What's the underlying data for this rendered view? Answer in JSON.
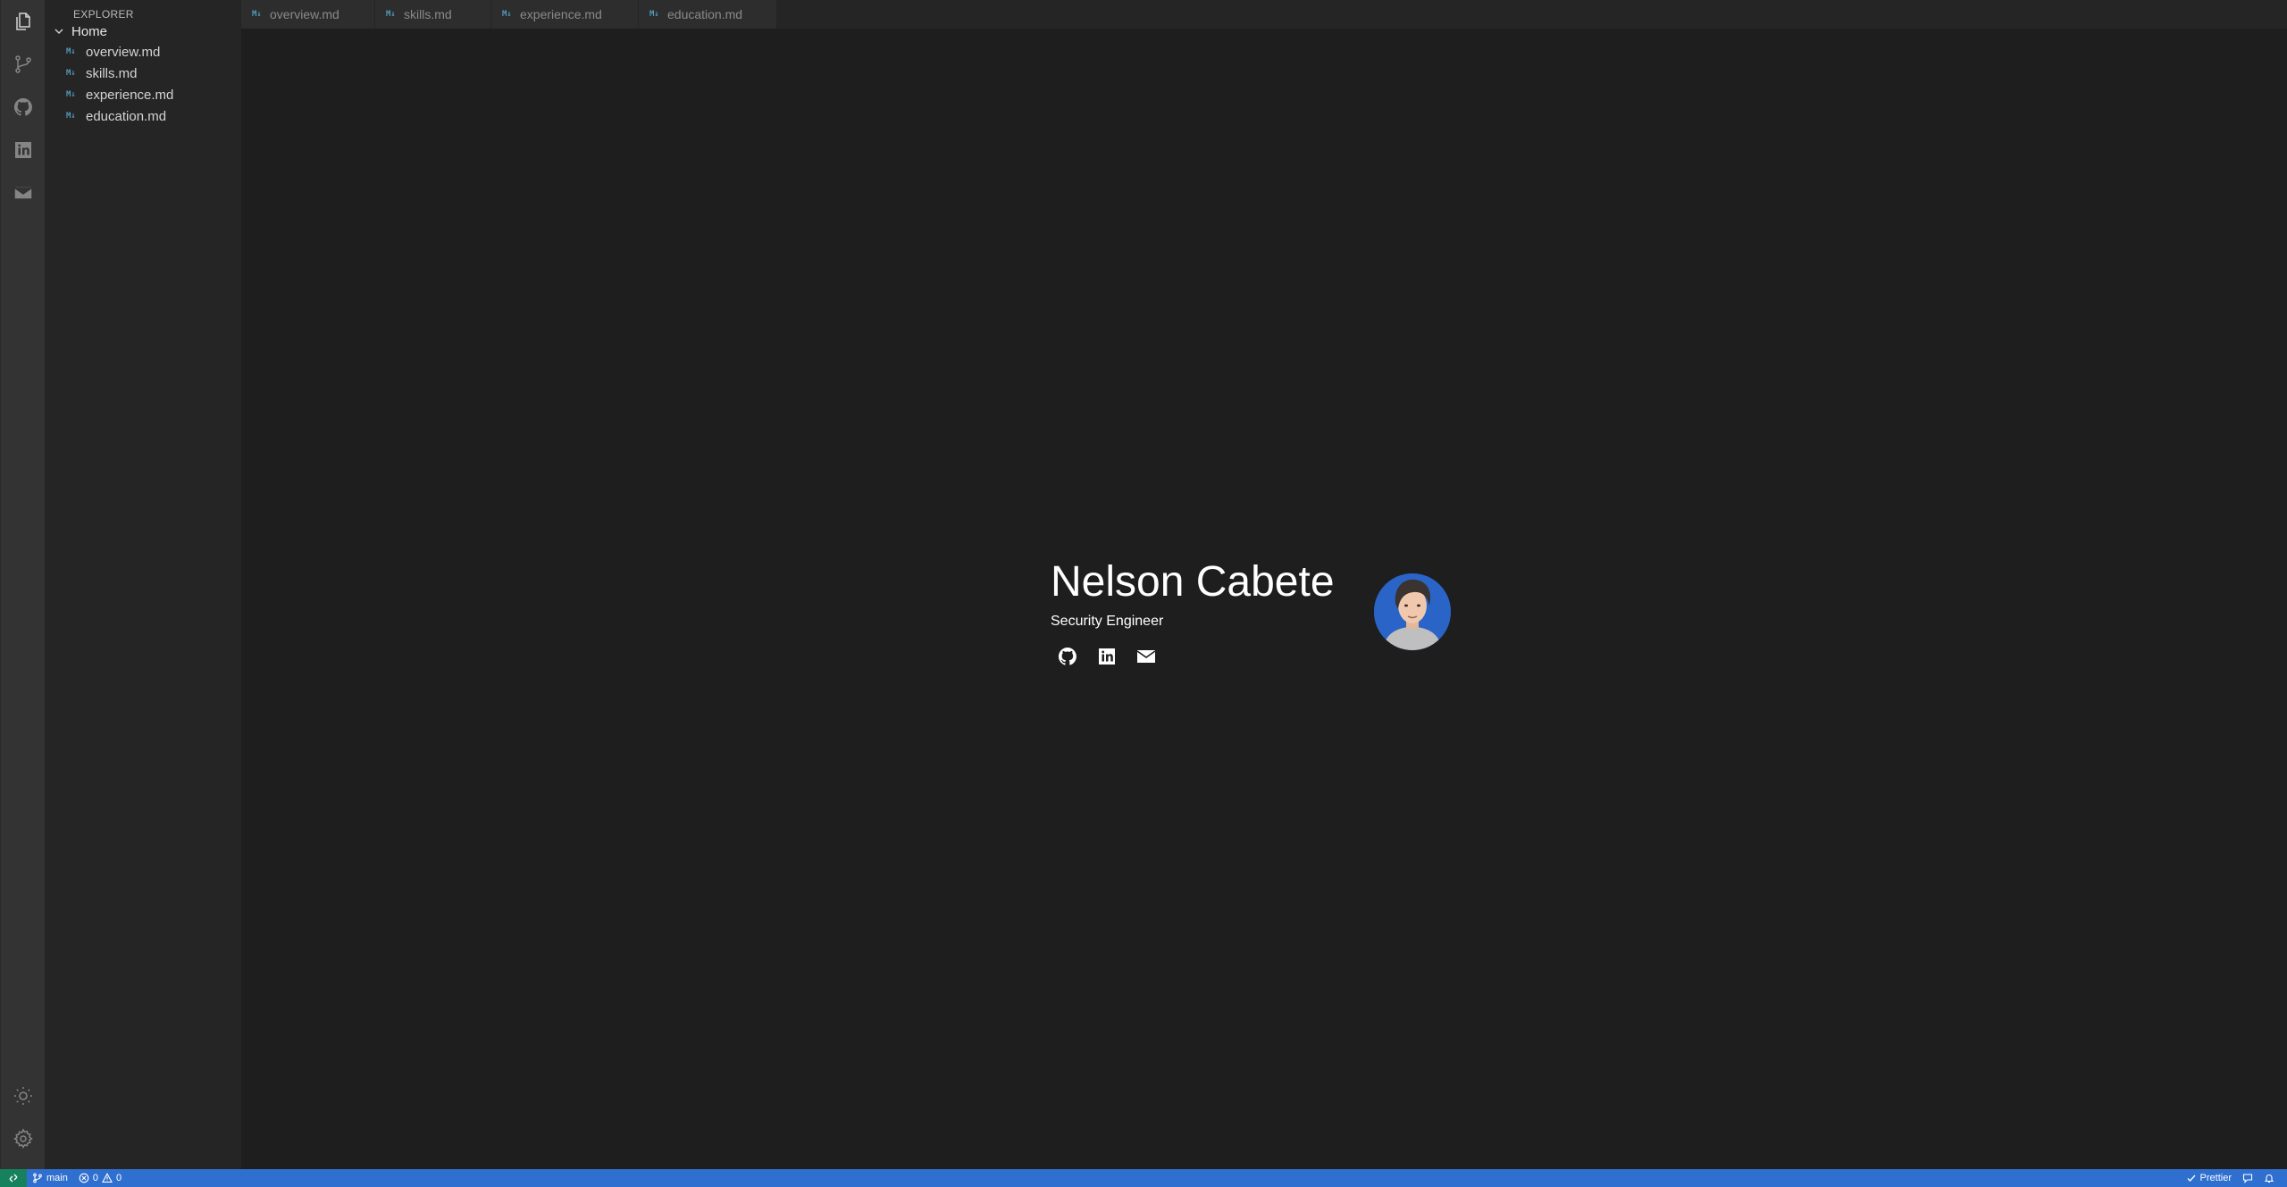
{
  "sidebar": {
    "title": "EXPLORER",
    "root_label": "Home",
    "items": [
      {
        "label": "overview.md",
        "icon": "M↓"
      },
      {
        "label": "skills.md",
        "icon": "M↓"
      },
      {
        "label": "experience.md",
        "icon": "M↓"
      },
      {
        "label": "education.md",
        "icon": "M↓"
      }
    ]
  },
  "activity_bar": {
    "icons": [
      "files-icon",
      "source-control-icon",
      "github-icon",
      "linkedin-icon",
      "mail-icon"
    ],
    "bottom_icons": [
      "theme-icon",
      "settings-icon"
    ]
  },
  "tabs": [
    {
      "label": "overview.md",
      "icon": "M↓"
    },
    {
      "label": "skills.md",
      "icon": "M↓"
    },
    {
      "label": "experience.md",
      "icon": "M↓"
    },
    {
      "label": "education.md",
      "icon": "M↓"
    }
  ],
  "hero": {
    "name": "Nelson Cabete",
    "role": "Security Engineer",
    "links": [
      "github-icon",
      "linkedin-icon",
      "mail-icon"
    ]
  },
  "statusbar": {
    "branch": "main",
    "errors": "0",
    "warnings": "0",
    "formatter": "Prettier"
  },
  "colors": {
    "statusbar": "#2f6fcf",
    "remote": "#16825d",
    "markdown_icon": "#519aba"
  }
}
